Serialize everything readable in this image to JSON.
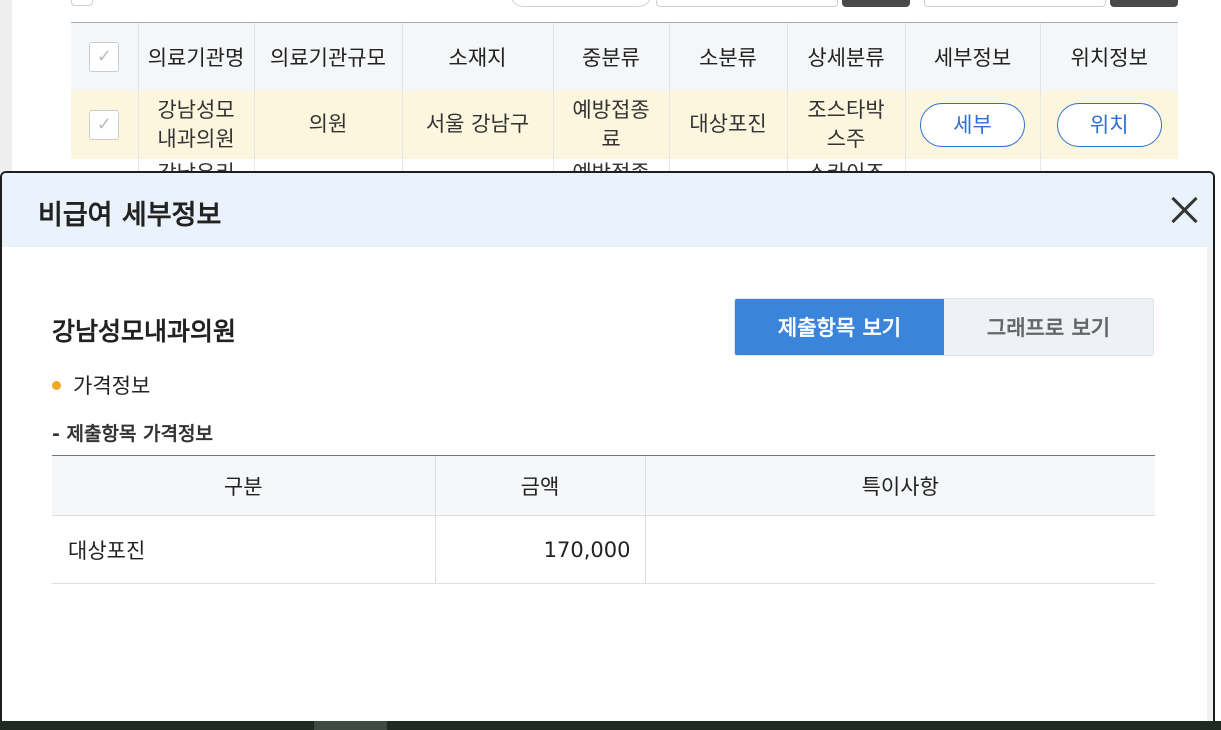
{
  "background_table": {
    "headers": [
      "의료기관명",
      "의료기관규모",
      "소재지",
      "중분류",
      "소분류",
      "상세분류",
      "세부정보",
      "위치정보"
    ],
    "row": {
      "name": "강남성모\n내과의원",
      "size": "의원",
      "location": "서울 강남구",
      "category_mid": "예방접종\n료",
      "category_small": "대상포진",
      "category_detail": "조스타박\n스주",
      "detail_button": "세부",
      "location_button": "위치"
    },
    "next_row_partial": {
      "name": "강남우리",
      "category_mid": "예방접종",
      "category_detail": "스카이조"
    }
  },
  "modal": {
    "title": "비급여 세부정보",
    "hospital_name": "강남성모내과의원",
    "tabs": [
      {
        "label": "제출항목 보기",
        "active": true
      },
      {
        "label": "그래프로 보기",
        "active": false
      }
    ],
    "section_title": "가격정보",
    "sub_title": "- 제출항목 가격정보",
    "price_table": {
      "headers": [
        "구분",
        "금액",
        "특이사항"
      ],
      "rows": [
        {
          "category": "대상포진",
          "amount": "170,000",
          "note": ""
        }
      ]
    }
  },
  "colors": {
    "accent": "#3a84dc",
    "highlight_row": "#fdf6de",
    "modal_header": "#eaf2fb",
    "bullet": "#f5a623",
    "link_button": "#2f6fd0"
  },
  "icons": {
    "close": "close-icon",
    "checkbox": "check-icon"
  }
}
